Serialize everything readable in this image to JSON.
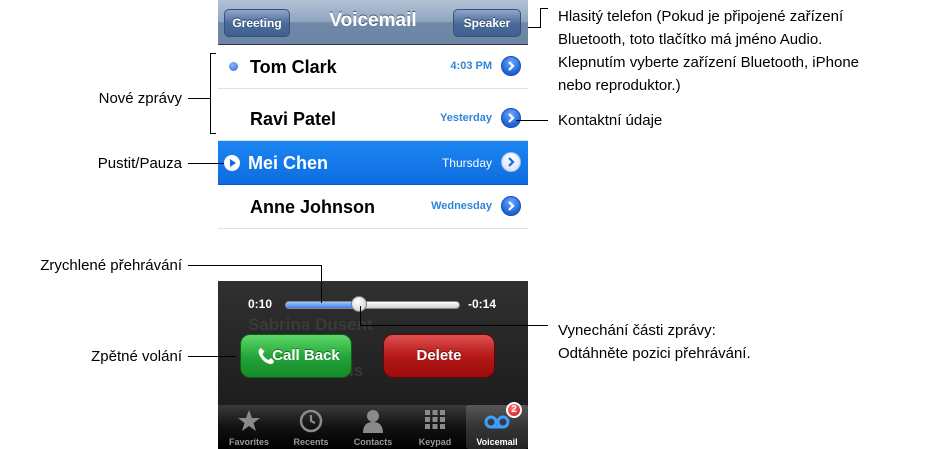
{
  "navbar": {
    "title": "Voicemail",
    "greeting": "Greeting",
    "speaker": "Speaker"
  },
  "messages": [
    {
      "name": "Tom Clark",
      "when": "4:03 PM",
      "new": true
    },
    {
      "name": "Ravi Patel",
      "when": "Yesterday",
      "new": false
    },
    {
      "name": "Mei Chen",
      "when": "Thursday",
      "selected": true
    },
    {
      "name": "Anne Johnson",
      "when": "Wednesday",
      "new": false
    }
  ],
  "player": {
    "elapsed": "0:10",
    "remaining": "-0:14",
    "progress": 0.42,
    "ghost_row_1": "Sabrina Dusent",
    "ghost_row_2": "Donna Dubois",
    "callback": "Call Back",
    "delete": "Delete"
  },
  "tabbar": {
    "tabs": [
      "Favorites",
      "Recents",
      "Contacts",
      "Keypad",
      "Voicemail"
    ],
    "badge": "2"
  },
  "callouts": {
    "speaker": [
      "Hlasitý telefon (Pokud je připojené zařízení",
      "Bluetooth, toto tlačítko má jméno Audio.",
      "Klepnutím vyberte zařízení Bluetooth, iPhone",
      "nebo reproduktor.)"
    ],
    "contact": "Kontaktní údaje",
    "new_messages": "Nové zprávy",
    "play_pause": "Pustit/Pauza",
    "scrub": "Zrychlené přehrávání",
    "skip": [
      "Vynechání části zprávy:",
      "Odtáhněte pozici přehrávání."
    ],
    "callback": "Zpětné volání"
  },
  "colors": {
    "accent": "#0e6ce0",
    "callback": "#25a63a",
    "delete": "#b51818"
  }
}
